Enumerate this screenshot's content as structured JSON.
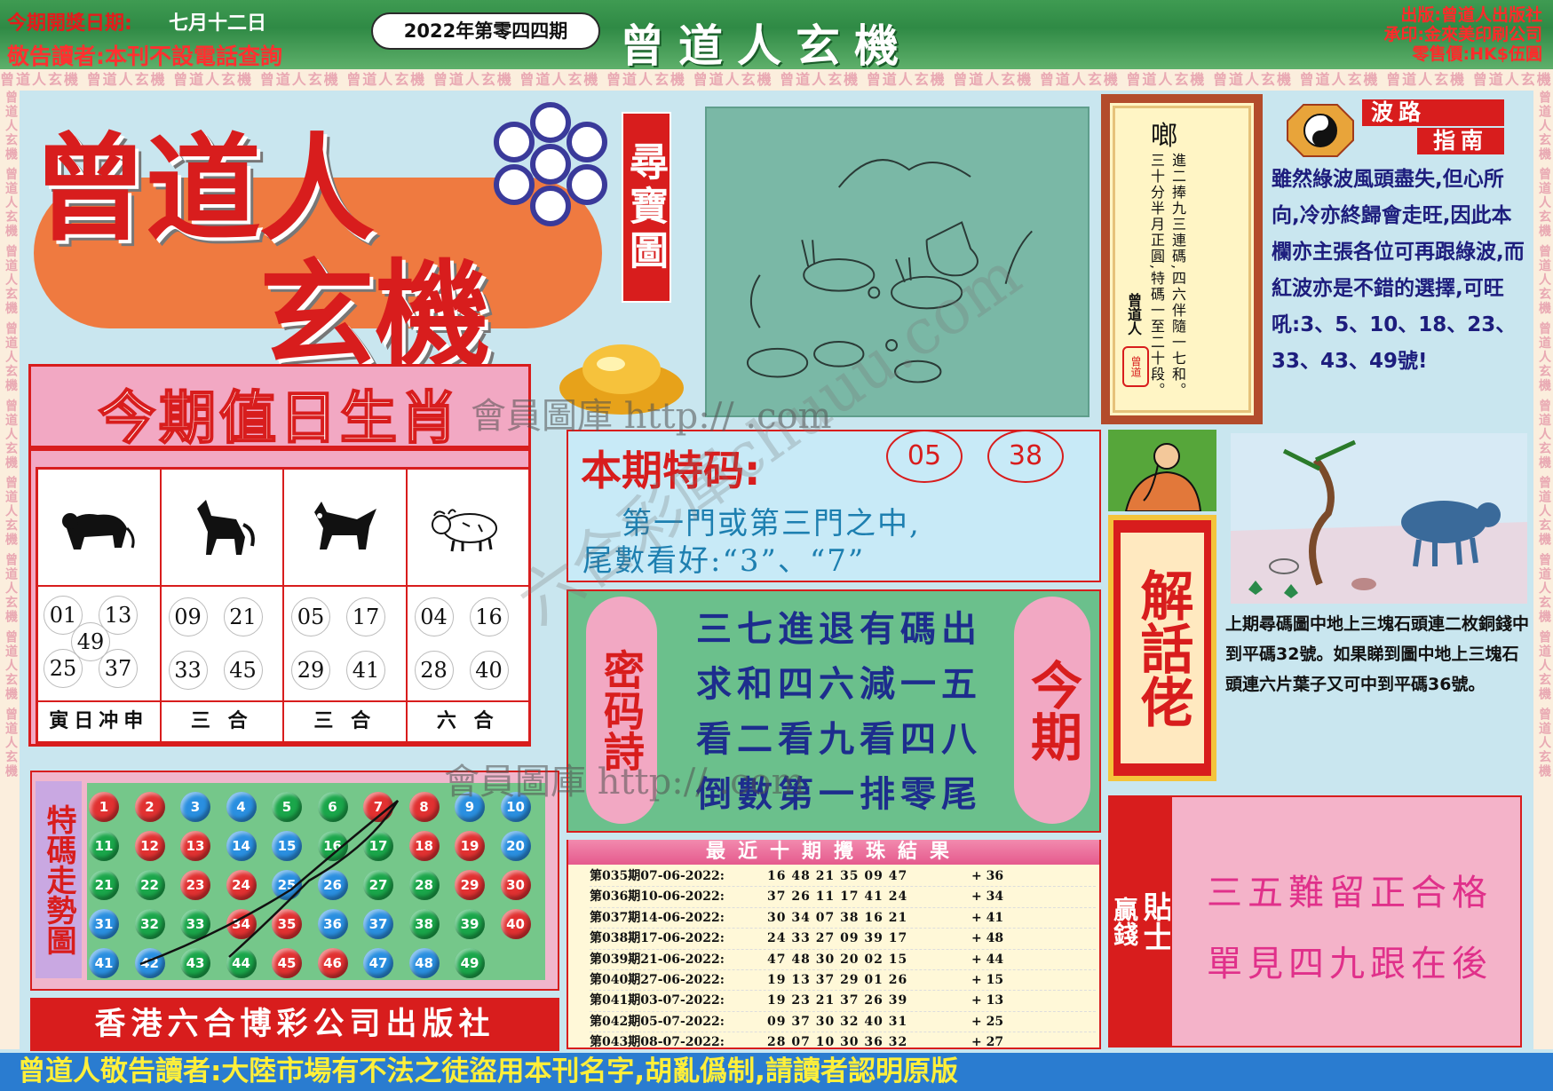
{
  "header": {
    "draw_date_label": "今期開獎日期:",
    "draw_date_value": "七月十二日",
    "warning": "敬告讀者:本刊不設電話查詢",
    "issue": "2022年第零四四期",
    "masthead": "曾道人玄機",
    "publisher_lines": [
      "出版:曾道人出版社",
      "承印:金來美印刷公司",
      "零售價:HK$伍圓"
    ]
  },
  "band_text": "曾道人玄機 曾道人玄機 曾道人玄機 曾道人玄機 曾道人玄機 曾道人玄機 曾道人玄機 曾道人玄機 曾道人玄機 曾道人玄機 曾道人玄機 曾道人玄機 曾道人玄機 曾道人玄機 曾道人玄機 曾道人玄機 曾道人玄機 曾道人玄機 曾道人玄機",
  "side_text": "曾道人玄機 曾道人玄機 曾道人玄機 曾道人玄機 曾道人玄機 曾道人玄機 曾道人玄機 曾道人玄機 曾道人玄機",
  "logo": {
    "line1": "曾道人",
    "line2": "玄機",
    "tag": "尋寶圖"
  },
  "zodiac": {
    "title": "今期值日生肖",
    "cols": [
      {
        "animal": "tiger",
        "numbers": [
          "01",
          "13",
          "49",
          "25",
          "37"
        ],
        "footer": "寅日冲申"
      },
      {
        "animal": "horse",
        "numbers": [
          "09",
          "21",
          "33",
          "45"
        ],
        "footer": "三 合"
      },
      {
        "animal": "dog",
        "numbers": [
          "05",
          "17",
          "29",
          "41"
        ],
        "footer": "三 合"
      },
      {
        "animal": "ox",
        "numbers": [
          "04",
          "16",
          "28",
          "40"
        ],
        "footer": "六 合"
      }
    ]
  },
  "trend": {
    "title": "特碼走勢圖",
    "balls": [
      {
        "n": "1",
        "c": "r"
      },
      {
        "n": "2",
        "c": "r"
      },
      {
        "n": "3",
        "c": "b"
      },
      {
        "n": "4",
        "c": "b"
      },
      {
        "n": "5",
        "c": "g"
      },
      {
        "n": "6",
        "c": "g"
      },
      {
        "n": "7",
        "c": "r"
      },
      {
        "n": "8",
        "c": "r"
      },
      {
        "n": "9",
        "c": "b"
      },
      {
        "n": "10",
        "c": "b"
      },
      {
        "n": "11",
        "c": "g"
      },
      {
        "n": "12",
        "c": "r"
      },
      {
        "n": "13",
        "c": "r"
      },
      {
        "n": "14",
        "c": "b"
      },
      {
        "n": "15",
        "c": "b"
      },
      {
        "n": "16",
        "c": "g"
      },
      {
        "n": "17",
        "c": "g"
      },
      {
        "n": "18",
        "c": "r"
      },
      {
        "n": "19",
        "c": "r"
      },
      {
        "n": "20",
        "c": "b"
      },
      {
        "n": "21",
        "c": "g"
      },
      {
        "n": "22",
        "c": "g"
      },
      {
        "n": "23",
        "c": "r"
      },
      {
        "n": "24",
        "c": "r"
      },
      {
        "n": "25",
        "c": "b"
      },
      {
        "n": "26",
        "c": "b"
      },
      {
        "n": "27",
        "c": "g"
      },
      {
        "n": "28",
        "c": "g"
      },
      {
        "n": "29",
        "c": "r"
      },
      {
        "n": "30",
        "c": "r"
      },
      {
        "n": "31",
        "c": "b"
      },
      {
        "n": "32",
        "c": "g"
      },
      {
        "n": "33",
        "c": "g"
      },
      {
        "n": "34",
        "c": "r"
      },
      {
        "n": "35",
        "c": "r"
      },
      {
        "n": "36",
        "c": "b"
      },
      {
        "n": "37",
        "c": "b"
      },
      {
        "n": "38",
        "c": "g"
      },
      {
        "n": "39",
        "c": "g"
      },
      {
        "n": "40",
        "c": "r"
      },
      {
        "n": "41",
        "c": "b"
      },
      {
        "n": "42",
        "c": "b"
      },
      {
        "n": "43",
        "c": "g"
      },
      {
        "n": "44",
        "c": "g"
      },
      {
        "n": "45",
        "c": "r"
      },
      {
        "n": "46",
        "c": "r"
      },
      {
        "n": "47",
        "c": "b"
      },
      {
        "n": "48",
        "c": "b"
      },
      {
        "n": "49",
        "c": "g"
      }
    ]
  },
  "publisher_footer": "香港六合博彩公司出版社",
  "poem": {
    "head": "啷",
    "body": "進二捧九三連碼,四六伴隨一七和。三十分半月正圓,特碼一至二十段。",
    "sign": "曾道人",
    "seal": "曾道"
  },
  "wave": {
    "title1": "波路",
    "title2": "指南",
    "text": "雖然綠波風頭盡失,但心所向,冷亦終歸會走旺,因此本欄亦主張各位可再跟綠波,而紅波亦是不錯的選擇,可旺吼:3、5、10、18、23、33、43、49號!"
  },
  "special": {
    "label": "本期特码:",
    "numbers": [
      "05",
      "38"
    ],
    "line1": "第一門或第三門之中,",
    "line2": "尾數看好:“3”、“7”"
  },
  "secret": {
    "tag": "密码詩",
    "lines": [
      "三七進退有碼出",
      "求和四六減一五",
      "看二看九看四八",
      "倒數第一排零尾"
    ],
    "tag2": "今期"
  },
  "results": {
    "title": "最近十期攪珠結果",
    "rows": [
      {
        "label": "第035期07-06-2022:",
        "nums": "16 48 21 35 09 47",
        "special": "36"
      },
      {
        "label": "第036期10-06-2022:",
        "nums": "37 26 11 17 41 24",
        "special": "34"
      },
      {
        "label": "第037期14-06-2022:",
        "nums": "30 34 07 38 16 21",
        "special": "41"
      },
      {
        "label": "第038期17-06-2022:",
        "nums": "24 33 27 09 39 17",
        "special": "48"
      },
      {
        "label": "第039期21-06-2022:",
        "nums": "47 48 30 20 02 15",
        "special": "44"
      },
      {
        "label": "第040期27-06-2022:",
        "nums": "19 13 37 29 01 26",
        "special": "15"
      },
      {
        "label": "第041期03-07-2022:",
        "nums": "19 23 21 37 26 39",
        "special": "13"
      },
      {
        "label": "第042期05-07-2022:",
        "nums": "09 37 30 32 40 31",
        "special": "25"
      },
      {
        "label": "第043期08-07-2022:",
        "nums": "28 07 10 30 36 32",
        "special": "27"
      }
    ]
  },
  "explain": {
    "tag": "解話佬",
    "note": "上期尋碼圖中地上三塊石頭連二枚銅錢中到平碼32號。如果睇到圖中地上三塊石頭連六片葉子又可中到平碼36號。"
  },
  "tips": {
    "tag1": "贏錢",
    "tag2": "貼士",
    "line1": "三五難留正合格",
    "line2": "單見四九跟在後"
  },
  "bottom_warning": "曾道人敬告讀者:大陸市場有不法之徒盜用本刊名字,胡亂僞制,請讀者認明原版",
  "watermark": {
    "line1": "會員圖庫 http:// .com",
    "line2": "會員圖庫 http:// .com",
    "diag": "六合彩庫chuuu.com"
  }
}
